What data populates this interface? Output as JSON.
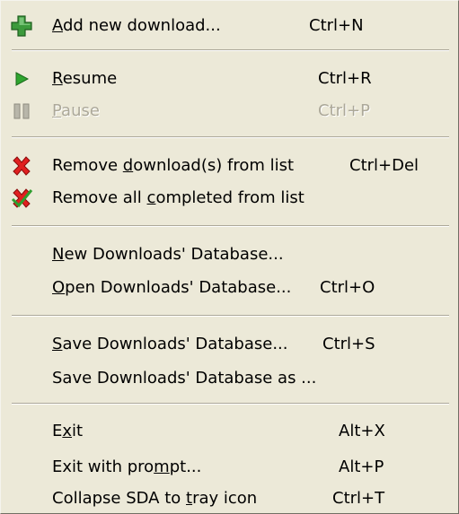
{
  "menu": {
    "add": {
      "pre": "",
      "key": "A",
      "post": "dd new download...",
      "shortcut": "Ctrl+N"
    },
    "resume": {
      "pre": "",
      "key": "R",
      "post": "esume",
      "shortcut": "Ctrl+R"
    },
    "pause": {
      "pre": "",
      "key": "P",
      "post": "ause",
      "shortcut": "Ctrl+P"
    },
    "remove": {
      "pre": "Remove ",
      "key": "d",
      "post": "ownload(s) from list",
      "shortcut": "Ctrl+Del"
    },
    "remove_completed": {
      "pre": "Remove all ",
      "key": "c",
      "post": "ompleted from list",
      "shortcut": ""
    },
    "new_db": {
      "pre": "",
      "key": "N",
      "post": "ew Downloads' Database...",
      "shortcut": ""
    },
    "open_db": {
      "pre": "",
      "key": "O",
      "post": "pen Downloads' Database...",
      "shortcut": "Ctrl+O"
    },
    "save_db": {
      "pre": "",
      "key": "S",
      "post": "ave Downloads' Database...",
      "shortcut": "Ctrl+S"
    },
    "save_db_as": {
      "pre": "Save Downloads' Database as ...",
      "key": "",
      "post": "",
      "shortcut": ""
    },
    "exit": {
      "pre": "E",
      "key": "x",
      "post": "it",
      "shortcut": "Alt+X"
    },
    "exit_prompt": {
      "pre": "Exit with pro",
      "key": "m",
      "post": "pt...",
      "shortcut": "Alt+P"
    },
    "collapse": {
      "pre": "Collapse SDA to ",
      "key": "t",
      "post": "ray icon",
      "shortcut": "Ctrl+T"
    }
  },
  "icons": {
    "add": "green-plus-icon",
    "resume": "green-play-icon",
    "pause": "pause-icon",
    "remove": "red-x-icon",
    "remove_completed": "red-x-check-icon"
  },
  "colors": {
    "menu_bg": "#ece9d8",
    "disabled_text": "#aca899",
    "separator": "#aca899"
  }
}
